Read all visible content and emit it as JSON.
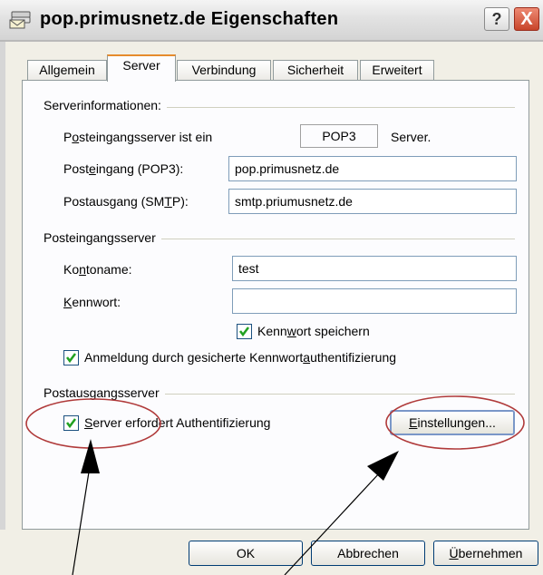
{
  "window": {
    "title": "pop.primusnetz.de Eigenschaften",
    "help_label": "?",
    "close_label": "X"
  },
  "tabs": [
    {
      "label": "Allgemein",
      "active": false
    },
    {
      "label": "Server",
      "active": true
    },
    {
      "label": "Verbindung",
      "active": false
    },
    {
      "label": "Sicherheit",
      "active": false
    },
    {
      "label": "Erweitert",
      "active": false
    }
  ],
  "server_info": {
    "group_label": "Serverinformationen:",
    "incoming_type": {
      "label_pre": "P",
      "label_ul": "o",
      "label_post": "steingangsserver ist ein",
      "value": "POP3",
      "suffix": "Server."
    },
    "incoming": {
      "label_pre": "Post",
      "label_ul": "e",
      "label_post": "ingang (POP3):",
      "value": "pop.primusnetz.de"
    },
    "outgoing": {
      "label_pre": "Postausgang (SM",
      "label_ul": "T",
      "label_post": "P):",
      "value": "smtp.priumusnetz.de"
    }
  },
  "incoming_server": {
    "group_label": "Posteingangsserver",
    "account": {
      "label_pre": "Ko",
      "label_ul": "n",
      "label_post": "toname:",
      "value": "test"
    },
    "password": {
      "label_pre": "",
      "label_ul": "K",
      "label_post": "ennwort:",
      "value": ""
    },
    "save_password": {
      "label_pre": "Kenn",
      "label_ul": "w",
      "label_post": "ort speichern",
      "checked": true
    },
    "spa": {
      "label_pre": "Anmeldung durch gesicherte Kennwort",
      "label_ul": "a",
      "label_post": "uthentifizierung",
      "checked": true
    }
  },
  "outgoing_server": {
    "group_label": "Postausgangsserver",
    "requires_auth": {
      "label_pre": "",
      "label_ul": "S",
      "label_post": "erver erfordert Authentifizierung",
      "checked": true
    },
    "settings_button": {
      "label_ul": "E",
      "label_post": "instellungen..."
    }
  },
  "footer": {
    "ok_label": "OK",
    "cancel_label": "Abbrechen",
    "apply_ul": "Ü",
    "apply_post": "bernehmen"
  },
  "colors": {
    "annotation": "#b03a3a",
    "check": "#21a121"
  }
}
